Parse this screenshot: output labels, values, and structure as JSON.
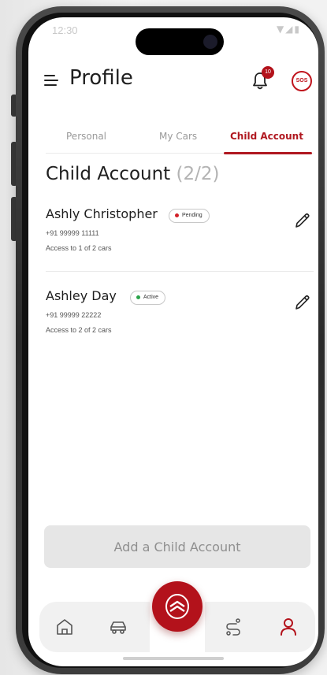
{
  "status_bar": {
    "time": "12:30",
    "icons": "▼◢▮"
  },
  "header": {
    "title": "Profile",
    "notification_count": "10",
    "sos_label": "SOS"
  },
  "tabs": [
    {
      "label": "Personal",
      "active": false
    },
    {
      "label": "My Cars",
      "active": false
    },
    {
      "label": "Child Account",
      "active": true
    }
  ],
  "section": {
    "title": "Child Account",
    "count": "(2/2)"
  },
  "accounts": [
    {
      "name": "Ashly Christopher",
      "status": "Pending",
      "phone": "+91 99999 11111",
      "access": "Access to 1 of 2 cars"
    },
    {
      "name": "Ashley Day",
      "status": "Active",
      "phone": "+91 99999 22222",
      "access": "Access to 2 of 2 cars"
    }
  ],
  "actions": {
    "add_label": "Add a Child Account"
  },
  "bottom_nav": {
    "items": [
      "home-icon",
      "car-icon",
      "route-icon",
      "profile-icon"
    ],
    "center": "brand-chevron-icon"
  },
  "colors": {
    "accent": "#b3121b",
    "pending": "#d12028",
    "active": "#2aa34a",
    "disabled_button": "#e6e6e6"
  }
}
